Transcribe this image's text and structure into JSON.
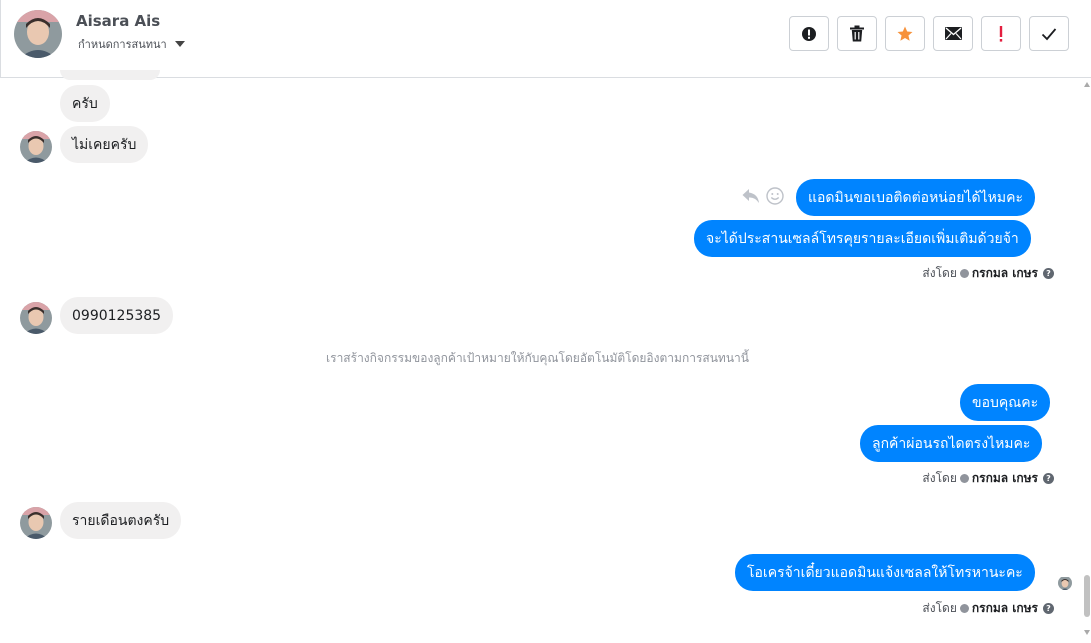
{
  "header": {
    "contact_name": "Aisara Ais",
    "conversation_settings_label": "กำหนดการสนทนา",
    "toolbar": [
      {
        "name": "spam-button",
        "icon": "alert-circle-icon"
      },
      {
        "name": "delete-button",
        "icon": "trash-icon"
      },
      {
        "name": "star-button",
        "icon": "star-icon",
        "color": "#f7923b"
      },
      {
        "name": "mark-unread-button",
        "icon": "envelope-icon"
      },
      {
        "name": "follow-up-button",
        "icon": "exclamation-icon",
        "color": "#e41e3f"
      },
      {
        "name": "mark-done-button",
        "icon": "checkmark-icon"
      }
    ]
  },
  "messages": {
    "m1": "ครับ",
    "m2": "ไม่เคยครับ",
    "m3": "แอดมินขอเบอติดต่อหน่อยได้ไหมคะ",
    "m4": "จะได้ประสานเซลล์โทรคุยรายละเอียดเพิ่มเติมด้วยจ้า",
    "m5": "0990125385",
    "m6": "ขอบคุณคะ",
    "m7": "ลูกค้าผ่อนรถไดตรงไหมคะ",
    "m8": "รายเดือนตงครับ",
    "m9": "โอเครจ้าเดี๋ยวแอดมินแจ้งเซลลให้โทรหานะคะ"
  },
  "sent_by": {
    "prefix": "ส่งโดย",
    "agent": "กรกมล เกษร",
    "help_glyph": "?"
  },
  "system_note": "เราสร้างกิจกรรมของลูกค้าเป้าหมายให้กับคุณโดยอัตโนมัติโดยอิงตามการสนทนานี้",
  "colors": {
    "outgoing_bubble": "#0084ff",
    "incoming_bubble": "#f1f0f0",
    "star": "#f7923b",
    "follow_up": "#e41e3f"
  }
}
